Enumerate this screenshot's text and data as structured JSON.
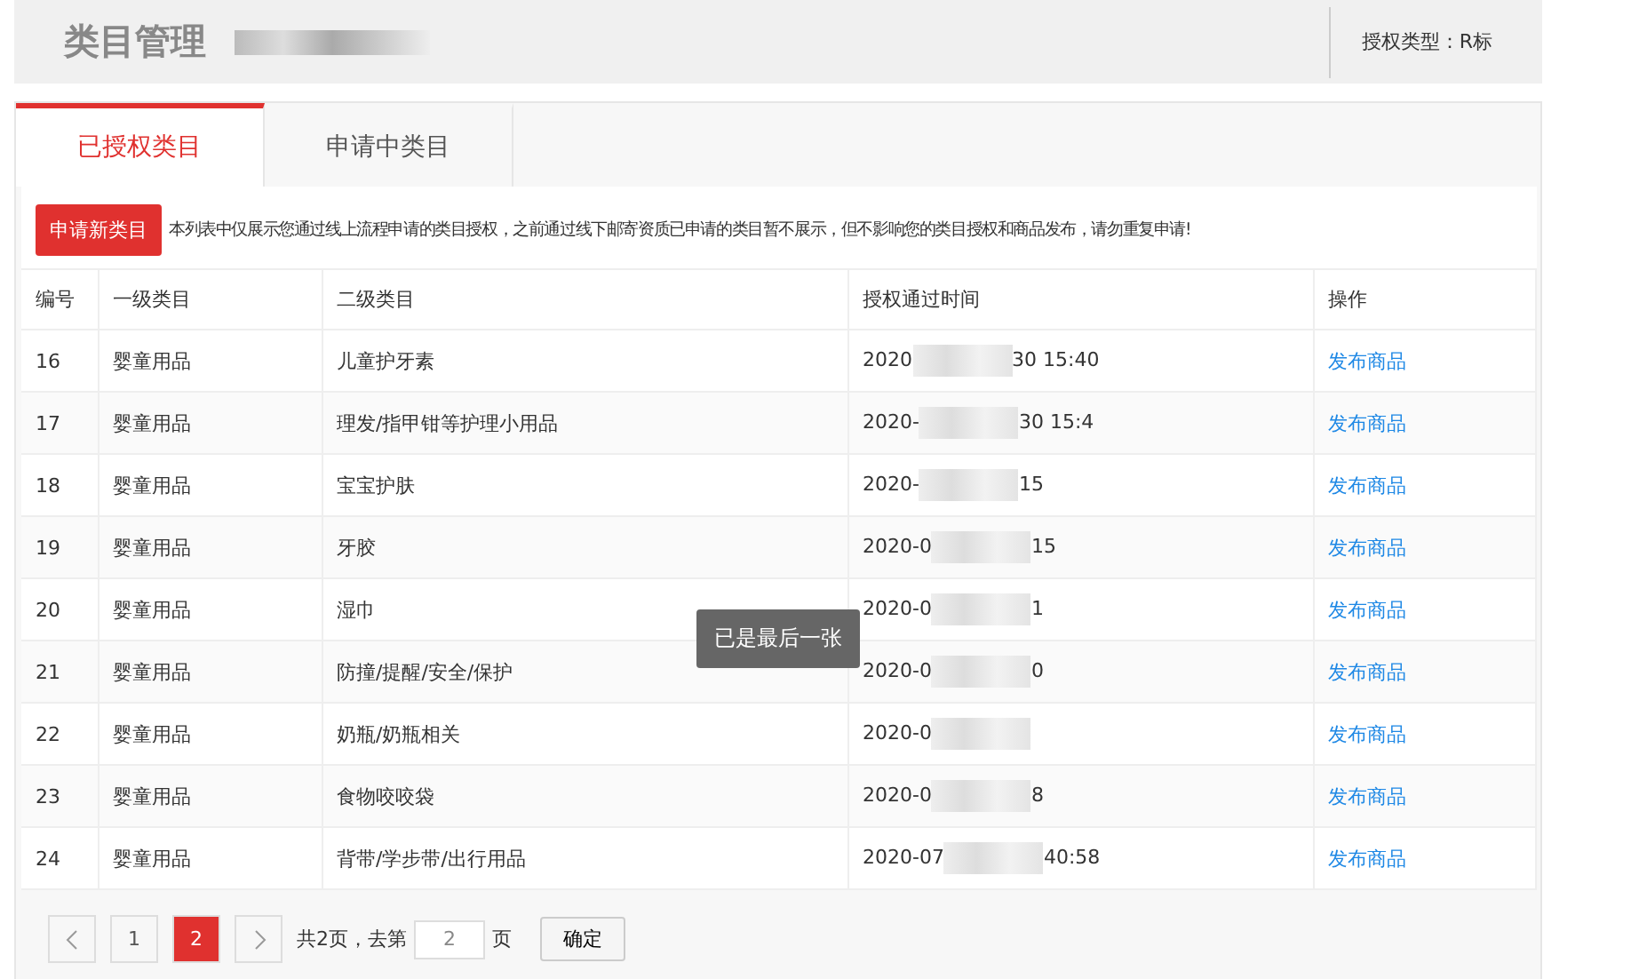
{
  "header": {
    "title": "类目管理",
    "auth_type": "授权类型：R标"
  },
  "tabs": [
    {
      "label": "已授权类目",
      "selected": true
    },
    {
      "label": "申请中类目",
      "selected": false
    }
  ],
  "toolbar": {
    "button": "申请新类目",
    "notice": "本列表中仅展示您通过线上流程申请的类目授权，之前通过线下邮寄资质已申请的类目暂不展示，但不影响您的类目授权和商品发布，请勿重复申请!"
  },
  "table": {
    "columns": [
      "编号",
      "一级类目",
      "二级类目",
      "授权通过时间",
      "操作"
    ],
    "rows": [
      {
        "id": "16",
        "level1": "婴童用品",
        "level2": "儿童护牙素",
        "time_start": "2020",
        "time_end": "30 15:40",
        "action": "发布商品"
      },
      {
        "id": "17",
        "level1": "婴童用品",
        "level2": "理发/指甲钳等护理小用品",
        "time_start": "2020-",
        "time_end": "30 15:4",
        "action": "发布商品"
      },
      {
        "id": "18",
        "level1": "婴童用品",
        "level2": "宝宝护肤",
        "time_start": "2020-",
        "time_end": "15",
        "action": "发布商品"
      },
      {
        "id": "19",
        "level1": "婴童用品",
        "level2": "牙胶",
        "time_start": "2020-0",
        "time_end": "15",
        "action": "发布商品"
      },
      {
        "id": "20",
        "level1": "婴童用品",
        "level2": "湿巾",
        "time_start": "2020-0",
        "time_end": "1",
        "action": "发布商品"
      },
      {
        "id": "21",
        "level1": "婴童用品",
        "level2": "防撞/提醒/安全/保护",
        "time_start": "2020-0",
        "time_end": "0",
        "action": "发布商品"
      },
      {
        "id": "22",
        "level1": "婴童用品",
        "level2": "奶瓶/奶瓶相关",
        "time_start": "2020-0",
        "action": "发布商品"
      },
      {
        "id": "23",
        "level1": "婴童用品",
        "level2": "食物咬咬袋",
        "time_start": "2020-0",
        "time_end": "8",
        "action": "发布商品"
      },
      {
        "id": "24",
        "level1": "婴童用品",
        "level2": "背带/学步带/出行用品",
        "time_start": "2020-07",
        "time_end": "40:58",
        "action": "发布商品"
      }
    ]
  },
  "pagination": {
    "pages": [
      {
        "label": "1",
        "selected": false
      },
      {
        "label": "2",
        "selected": true
      }
    ],
    "total": "共2页，去第",
    "page_input": "2",
    "unit": "页",
    "confirm": "确定"
  },
  "toast": "已是最后一张"
}
